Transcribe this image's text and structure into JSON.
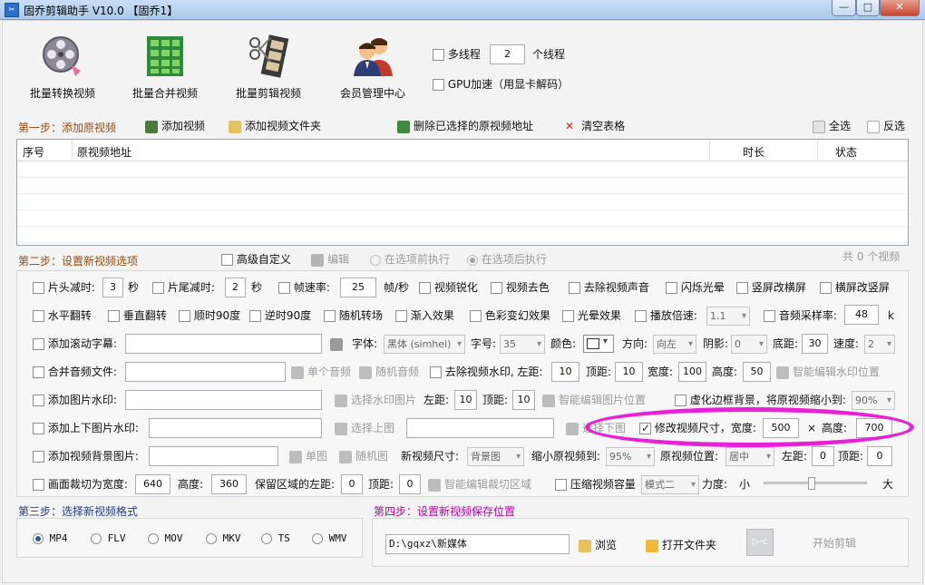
{
  "window": {
    "title": "固乔剪辑助手 V10.0 【固乔1】",
    "minimize": "—",
    "maximize": "□",
    "close": "✕"
  },
  "toolbar": [
    {
      "label": "批量转换视频",
      "icon": "film-reel-icon"
    },
    {
      "label": "批量合并视频",
      "icon": "merge-grid-icon"
    },
    {
      "label": "批量剪辑视频",
      "icon": "film-scissors-icon"
    },
    {
      "label": "会员管理中心",
      "icon": "members-icon"
    }
  ],
  "options": {
    "multithread_label": "多线程",
    "threads_value": "2",
    "threads_unit": "个线程",
    "gpu_label": "GPU加速（用显卡解码）"
  },
  "step1": {
    "title": "第一步：添加原视频",
    "add_video": "添加视频",
    "add_folder": "添加视频文件夹",
    "delete_selected": "删除已选择的原视频地址",
    "clear_table": "清空表格",
    "select_all": "全选",
    "invert": "反选",
    "columns": [
      "序号",
      "原视频地址",
      "时长",
      "状态"
    ]
  },
  "step2": {
    "title": "第二步：设置新视频选项",
    "advanced": "高级自定义",
    "edit": "编辑",
    "exec_before": "在选项前执行",
    "exec_after": "在选项后执行",
    "count": "共 0 个视频",
    "row1": {
      "head_cut": "片头减时:",
      "head_val": "3",
      "sec1": "秒",
      "tail_cut": "片尾减时:",
      "tail_val": "2",
      "sec2": "秒",
      "framerate": "帧速率:",
      "fps_val": "25",
      "fps_unit": "帧/秒",
      "sharpen": "视频锐化",
      "decolor": "视频去色",
      "remove_audio": "去除视频声音",
      "flash": "闪烁光晕",
      "v2h": "竖屏改横屏",
      "h2v": "横屏改竖屏"
    },
    "row2": {
      "hflip": "水平翻转",
      "vflip": "垂直翻转",
      "cw90": "顺时90度",
      "ccw90": "逆时90度",
      "random_trans": "随机转场",
      "fade_in": "渐入效果",
      "color_change": "色彩变幻效果",
      "halo": "光晕效果",
      "speed": "播放倍速:",
      "speed_val": "1.1",
      "sample_rate": "音频采样率:",
      "sample_val": "48",
      "sample_unit": "k"
    },
    "row3": {
      "scroll_sub": "添加滚动字幕:",
      "font": "字体:",
      "font_val": "黑体 (simhei)",
      "size": "字号:",
      "size_val": "35",
      "color": "颜色:",
      "direction": "方向:",
      "direction_val": "向左",
      "shadow": "阴影:",
      "shadow_val": "0",
      "bottom": "底距:",
      "bottom_val": "30",
      "spd": "速度:",
      "spd_val": "2"
    },
    "row4": {
      "merge_audio": "合并音频文件:",
      "single_audio": "单个音频",
      "random_audio": "随机音频",
      "remove_wm": "去除视频水印, 左距:",
      "left_val": "10",
      "top": "顶距:",
      "top_val": "10",
      "width": "宽度:",
      "width_val": "100",
      "height": "高度:",
      "height_val": "50",
      "smart_edit": "智能编辑水印位置"
    },
    "row5": {
      "img_wm": "添加图片水印:",
      "choose_img": "选择水印图片",
      "left": "左距:",
      "left_val": "10",
      "top": "顶距:",
      "top_val": "10",
      "smart_pos": "智能编辑图片位置",
      "blur_bg": "虚化边框背景，将原视频缩小到:",
      "blur_val": "90%"
    },
    "row6": {
      "tb_wm": "添加上下图片水印:",
      "choose_top": "选择上图",
      "choose_bottom": "选择下图",
      "resize": "修改视频尺寸，宽度:",
      "width_val": "500",
      "times": "×",
      "height": "高度:",
      "height_val": "700"
    },
    "row7": {
      "bg_img": "添加视频背景图片:",
      "single_img": "单图",
      "random_img": "随机图",
      "new_size": "新视频尺寸:",
      "new_size_val": "背景图",
      "shrink": "缩小原视频到:",
      "shrink_val": "95%",
      "position": "原视频位置:",
      "position_val": "居中",
      "left": "左距:",
      "left_val": "0",
      "top": "顶距:",
      "top_val": "0"
    },
    "row8": {
      "crop": "画面裁切为宽度:",
      "crop_w": "640",
      "height": "高度:",
      "crop_h": "360",
      "keep_left": "保留区域的左距:",
      "keep_left_val": "0",
      "top": "顶距:",
      "top_val": "0",
      "smart_crop": "智能编辑裁切区域",
      "compress": "压缩视频容量",
      "mode_val": "模式二",
      "strength": "力度:",
      "small": "小",
      "large": "大",
      "strength_level": 0.45
    }
  },
  "step3": {
    "title": "第三步：选择新视频格式",
    "formats": [
      "MP4",
      "FLV",
      "MOV",
      "MKV",
      "TS",
      "WMV"
    ],
    "selected": "MP4"
  },
  "step4": {
    "title": "第四步：设置新视频保存位置",
    "path": "D:\\gqxz\\新媒体",
    "browse": "浏览",
    "open_folder": "打开文件夹",
    "start": "开始剪辑",
    "start_icon_text": "▷·c"
  }
}
